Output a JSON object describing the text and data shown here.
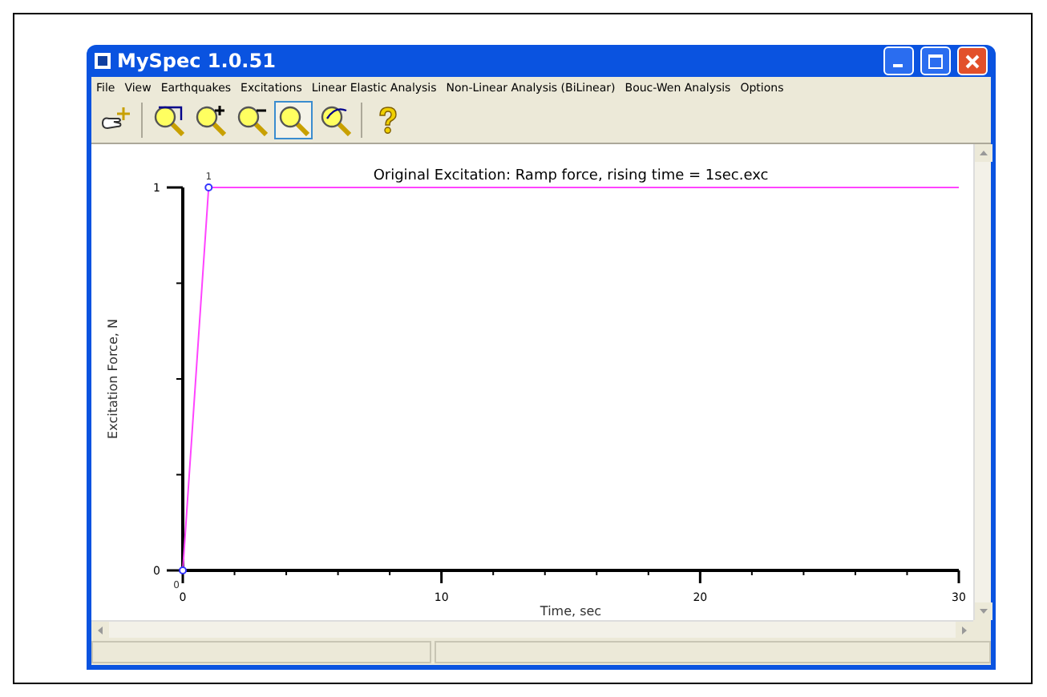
{
  "window": {
    "title": "MySpec 1.0.51"
  },
  "menu": [
    "File",
    "View",
    "Earthquakes",
    "Excitations",
    "Linear Elastic Analysis",
    "Non-Linear Analysis (BiLinear)",
    "Bouc-Wen Analysis",
    "Options"
  ],
  "toolbar": [
    {
      "kind": "pan",
      "selected": false
    },
    {
      "kind": "zoom-box",
      "selected": false
    },
    {
      "kind": "zoom-in",
      "selected": false
    },
    {
      "kind": "zoom-out",
      "selected": false
    },
    {
      "kind": "zoom-fit",
      "selected": true
    },
    {
      "kind": "zoom-reset",
      "selected": false
    },
    {
      "kind": "help",
      "selected": false
    }
  ],
  "plot": {
    "chart_data": {
      "type": "line",
      "title": "Original Excitation: Ramp force, rising time = 1sec.exc",
      "xlabel": "Time, sec",
      "ylabel": "Excitation Force, N",
      "x": [
        0,
        1,
        30
      ],
      "series": [
        {
          "color": "#ff44ff",
          "values": [
            0,
            1,
            1
          ]
        }
      ],
      "xlim": [
        0,
        30
      ],
      "ylim": [
        0,
        1
      ],
      "xticks": [
        0,
        10,
        20,
        30
      ],
      "yticks": [
        0,
        1
      ],
      "value_labels": [
        "0",
        "1",
        null
      ]
    }
  }
}
